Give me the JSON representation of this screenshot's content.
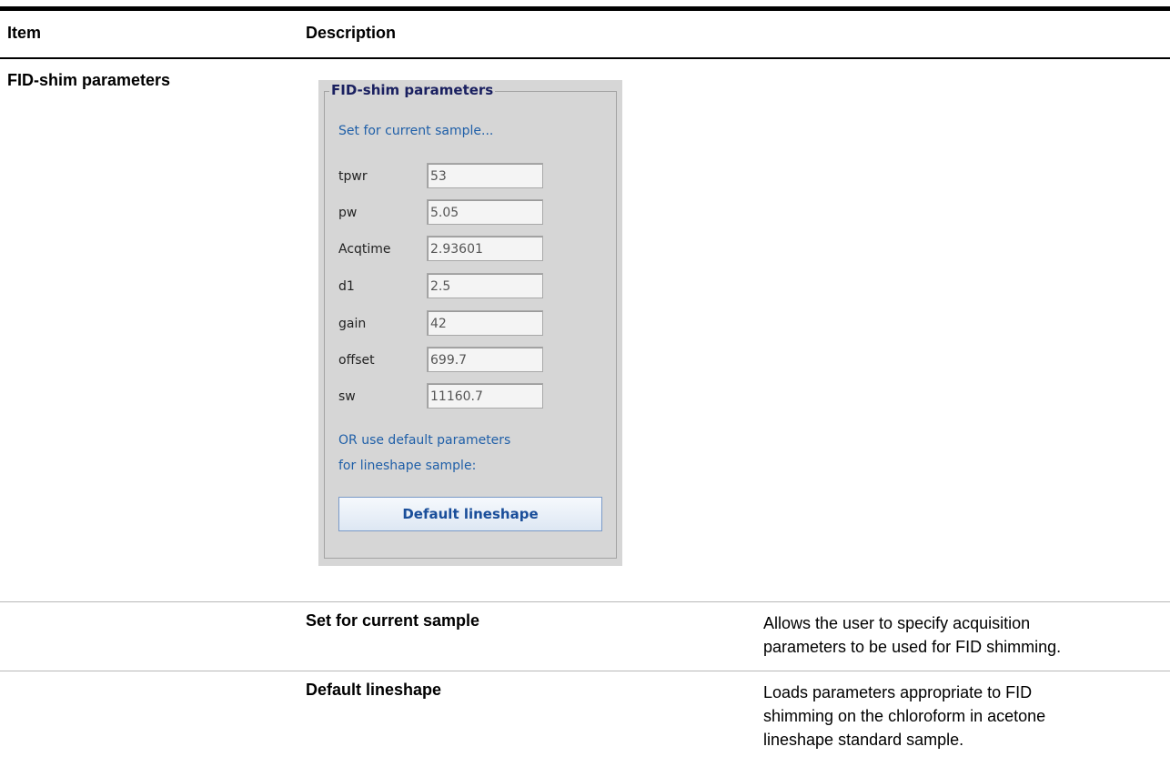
{
  "table": {
    "header": {
      "item": "Item",
      "description": "Description"
    },
    "section_title": "FID-shim parameters",
    "rows": [
      {
        "name": "Set for current sample",
        "desc_lines": [
          "Allows the user to specify acquisition",
          "parameters to be used for FID shimming."
        ]
      },
      {
        "name": "Default lineshape",
        "desc_lines": [
          "Loads parameters appropriate to FID",
          "shimming on the chloroform in acetone",
          "lineshape standard sample."
        ]
      }
    ]
  },
  "panel": {
    "legend": "FID-shim parameters",
    "set_current": "Set for current sample...",
    "params": [
      {
        "label": "tpwr",
        "value": "53"
      },
      {
        "label": "pw",
        "value": "5.05"
      },
      {
        "label": "Acqtime",
        "value": "2.93601"
      },
      {
        "label": "d1",
        "value": "2.5"
      },
      {
        "label": "gain",
        "value": "42"
      },
      {
        "label": "offset",
        "value": "699.7"
      },
      {
        "label": "sw",
        "value": "11160.7"
      }
    ],
    "or_line1": "OR use default parameters",
    "or_line2": "for lineshape sample:",
    "default_button": "Default lineshape"
  },
  "colors": {
    "legend_text": "#1a2060",
    "note_text": "#1f5fa8",
    "button_text": "#1a4e9a",
    "panel_bg": "#d6d6d6"
  }
}
